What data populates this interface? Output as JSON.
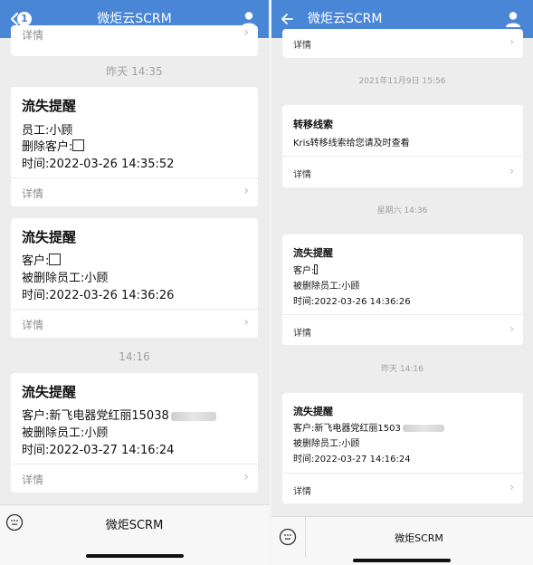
{
  "left": {
    "header": {
      "badge": "1",
      "title": "微炬云SCRM"
    },
    "top_partial_detail": "详情",
    "timestamps": [
      "昨天 14:35",
      "14:16"
    ],
    "cards": [
      {
        "title": "流失提醒",
        "lines": [
          "员工:小顾",
          "删除客户:",
          "时间:2022-03-26 14:35:52"
        ],
        "detail": "详情"
      },
      {
        "title": "流失提醒",
        "lines": [
          "客户:",
          "被删除员工:小顾",
          "时间:2022-03-26 14:36:26"
        ],
        "detail": "详情"
      },
      {
        "title": "流失提醒",
        "lines": [
          "客户:新飞电器党红丽15038",
          "被删除员工:小顾",
          "时间:2022-03-27 14:16:24"
        ],
        "detail": "详情"
      }
    ],
    "footer": {
      "label": "微炬SCRM"
    }
  },
  "right": {
    "header": {
      "title": "微炬云SCRM"
    },
    "top_partial_detail": "详情",
    "timestamps": [
      "2021年11月9日 15:56",
      "星期六 14:36",
      "昨天 14:16"
    ],
    "cards": [
      {
        "title": "转移线索",
        "lines": [
          "Kris转移线索给您请及时查看"
        ],
        "detail": "详情"
      },
      {
        "title": "流失提醒",
        "lines": [
          "客户:",
          "被删除员工:小顾",
          "时间:2022-03-26 14:36:26"
        ],
        "detail": "详情"
      },
      {
        "title": "流失提醒",
        "lines": [
          "客户:新飞电器党红丽1503",
          "被删除员工:小顾",
          "时间:2022-03-27 14:16:24"
        ],
        "detail": "详情"
      }
    ],
    "footer": {
      "label": "微炬SCRM"
    }
  },
  "icons": {
    "back": "chevron-left-icon",
    "user": "user-icon",
    "chevron": "chevron-right-icon",
    "keyboard": "keyboard-icon"
  },
  "colors": {
    "header": "#4a86d6",
    "background": "#ededed",
    "card": "#ffffff"
  }
}
